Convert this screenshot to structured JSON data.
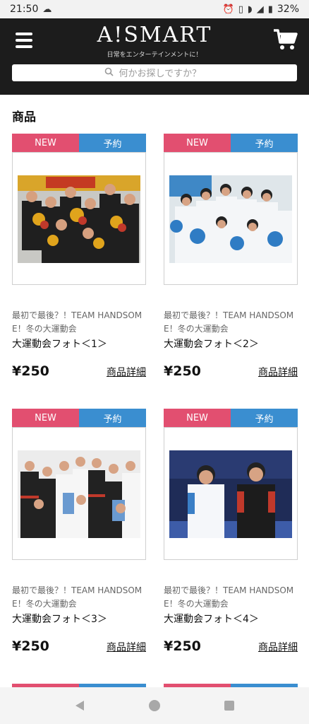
{
  "status_bar": {
    "time": "21:50",
    "battery": "32%"
  },
  "header": {
    "logo": "A!SMART",
    "tagline": "日常をエンターテインメントに！",
    "search_placeholder": "何かお探しですか？"
  },
  "section_title": "商品",
  "tag_new": "NEW",
  "tag_reserve": "予約",
  "detail_label": "商品詳細",
  "products": [
    {
      "subtitle": "最初で最後？！TEAM HANDSOM E！冬の大運動会",
      "name": "大運動会フォト＜1＞",
      "price": "¥250"
    },
    {
      "subtitle": "最初で最後？！TEAM HANDSOM E！冬の大運動会",
      "name": "大運動会フォト＜2＞",
      "price": "¥250"
    },
    {
      "subtitle": "最初で最後？！TEAM HANDSOM E！冬の大運動会",
      "name": "大運動会フォト＜3＞",
      "price": "¥250"
    },
    {
      "subtitle": "最初で最後？！TEAM HANDSOM E！冬の大運動会",
      "name": "大運動会フォト＜4＞",
      "price": "¥250"
    }
  ],
  "colors": {
    "header_bg": "#1c1c1c",
    "tag_new": "#e24f70",
    "tag_reserve": "#3a8ed0"
  }
}
